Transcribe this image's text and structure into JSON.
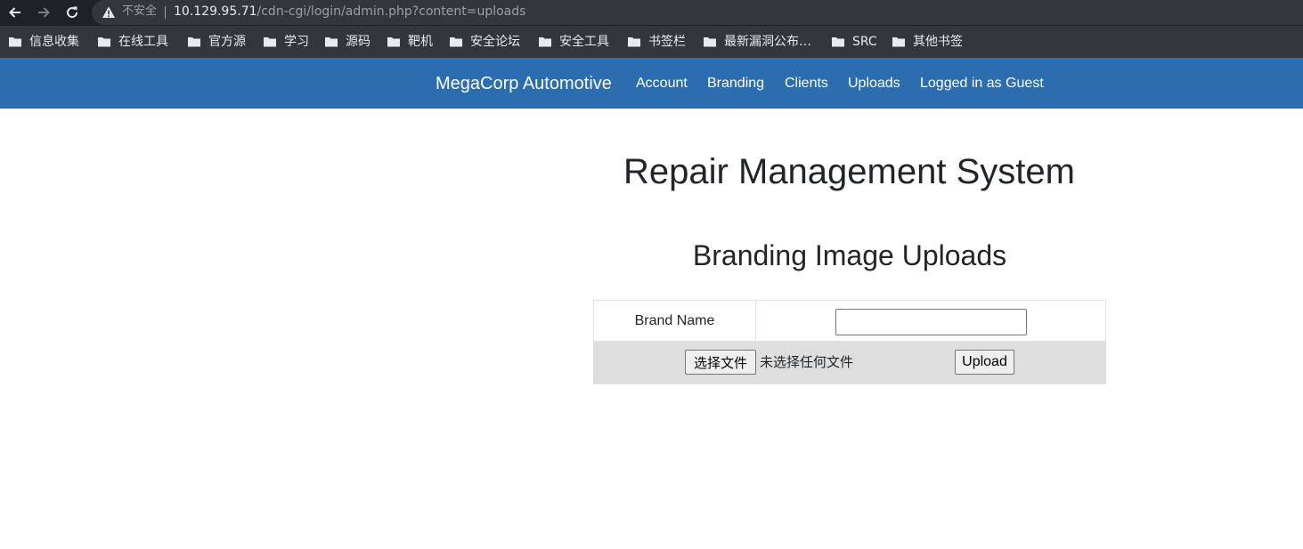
{
  "browser": {
    "security_label": "不安全",
    "url_host": "10.129.95.71",
    "url_path": "/cdn-cgi/login/admin.php?content=uploads",
    "nav_icons": [
      "back-arrow-icon",
      "forward-arrow-icon",
      "reload-icon",
      "warning-triangle-icon"
    ],
    "bookmarks": [
      {
        "label": "信息收集",
        "icon": "folder-icon"
      },
      {
        "label": "在线工具",
        "icon": "folder-icon"
      },
      {
        "label": "官方源",
        "icon": "folder-icon"
      },
      {
        "label": "学习",
        "icon": "folder-icon"
      },
      {
        "label": "源码",
        "icon": "folder-icon"
      },
      {
        "label": "靶机",
        "icon": "folder-icon"
      },
      {
        "label": "安全论坛",
        "icon": "folder-icon"
      },
      {
        "label": "安全工具",
        "icon": "folder-icon"
      },
      {
        "label": "书签栏",
        "icon": "folder-icon"
      },
      {
        "label": "最新漏洞公布…",
        "icon": "folder-icon"
      },
      {
        "label": "SRC",
        "icon": "folder-icon"
      },
      {
        "label": "其他书签",
        "icon": "folder-icon"
      }
    ]
  },
  "site": {
    "brand": "MegaCorp Automotive",
    "nav": [
      "Account",
      "Branding",
      "Clients",
      "Uploads",
      "Logged in as Guest"
    ],
    "nav_color": "#2c6db0"
  },
  "main": {
    "title": "Repair Management System",
    "section_title": "Branding Image Uploads",
    "form": {
      "brand_name_label": "Brand Name",
      "brand_name_value": "",
      "file_button": "选择文件",
      "file_status": "未选择任何文件",
      "upload_button": "Upload"
    }
  }
}
